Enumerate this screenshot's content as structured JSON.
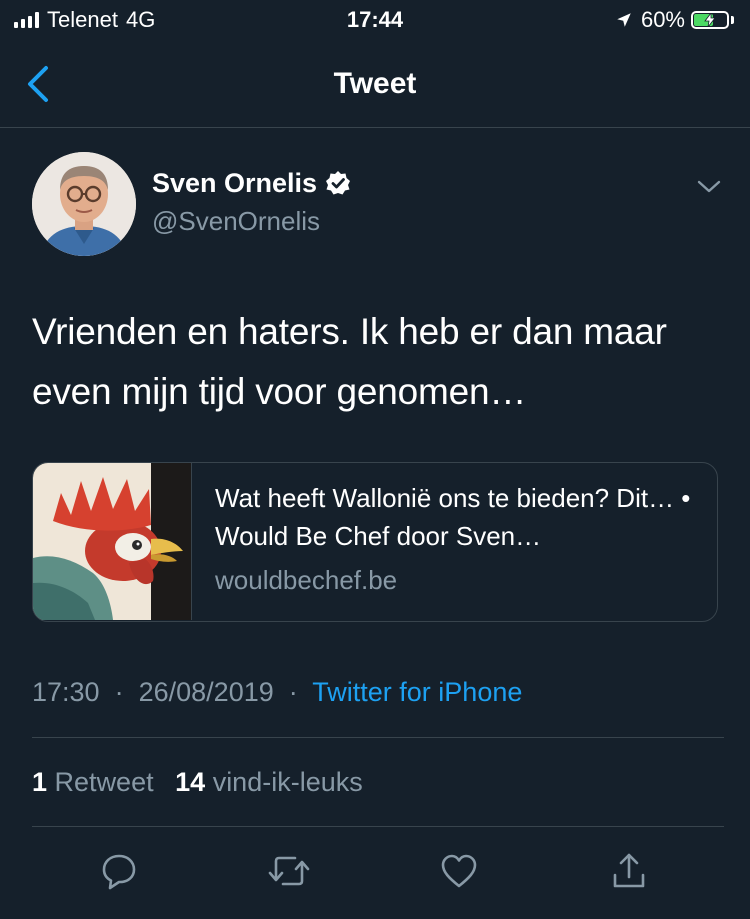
{
  "status_bar": {
    "carrier": "Telenet",
    "network": "4G",
    "time": "17:44",
    "battery": "60%",
    "battery_level": 0.6,
    "colors": {
      "battery_fill": "#4cd964"
    }
  },
  "header": {
    "title": "Tweet",
    "back_icon": "chevron-left-icon"
  },
  "tweet": {
    "author_name": "Sven Ornelis",
    "author_handle": "@SvenOrnelis",
    "verified": true,
    "text": "Vrienden en haters. Ik heb er dan maar even mijn tijd voor genomen…",
    "card": {
      "title": "Wat heeft Wallonië ons te bieden? Dit… • Would Be Chef door Sven…",
      "domain": "wouldbechef.be"
    },
    "time": "17:30",
    "date": "26/08/2019",
    "separator": "·",
    "source": "Twitter for iPhone",
    "retweet_count": "1",
    "retweet_label": "Retweet",
    "like_count": "14",
    "like_label": "vind-ik-leuks"
  },
  "actions": [
    {
      "name": "reply",
      "icon": "comment-icon"
    },
    {
      "name": "retweet",
      "icon": "retweet-icon"
    },
    {
      "name": "like",
      "icon": "heart-icon"
    },
    {
      "name": "share",
      "icon": "share-icon"
    }
  ],
  "colors": {
    "background": "#15202b",
    "accent": "#1da1f2",
    "secondary_text": "#8899a6",
    "divider": "#38444d"
  }
}
